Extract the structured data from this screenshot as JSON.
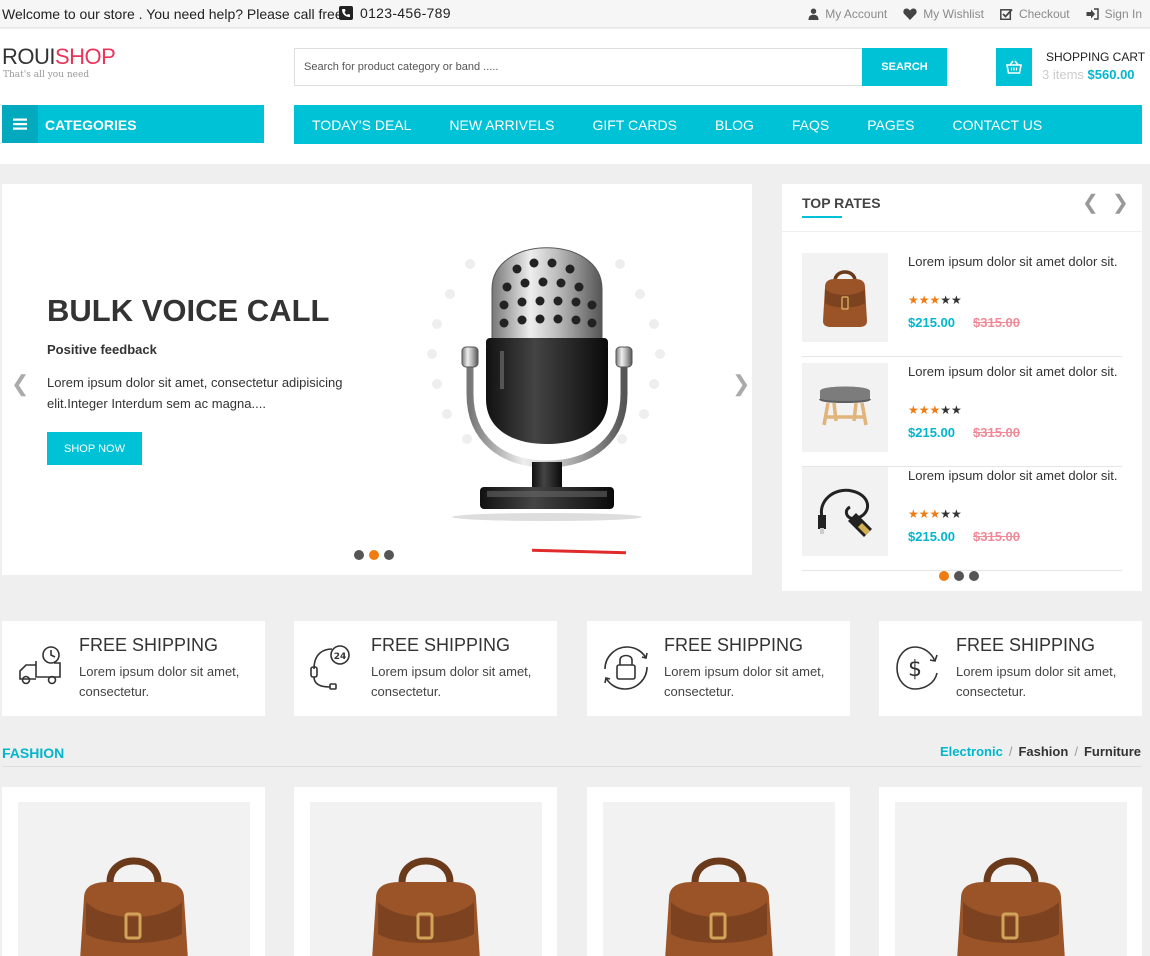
{
  "topbar": {
    "welcome": "Welcome to our store . You need help? Please call free",
    "phone": "0123-456-789",
    "links": [
      {
        "label": "My Account",
        "icon": "user-icon"
      },
      {
        "label": "My Wishlist",
        "icon": "heart-icon"
      },
      {
        "label": "Checkout",
        "icon": "checkbox-icon"
      },
      {
        "label": "Sign In",
        "icon": "sign-in-icon"
      }
    ]
  },
  "header": {
    "logo_part1": "ROUI",
    "logo_part2": "SHOP",
    "tagline": "That's all you need",
    "search_placeholder": "Search for product category or band .....",
    "search_button": "SEARCH",
    "cart_title": "SHOPPING CART",
    "cart_items": "3 items",
    "cart_total": "$560.00",
    "categories_label": "CATEGORIES",
    "nav": [
      "TODAY'S DEAL",
      "NEW ARRIVELS",
      "GIFT CARDS",
      "BLOG",
      "FAQS",
      "PAGES",
      "CONTACT US"
    ]
  },
  "hero": {
    "title": "BULK VOICE CALL",
    "subtitle": "Positive feedback",
    "description": "Lorem ipsum dolor sit amet, consectetur adipisicing elit.Integer Interdum sem ac magna....",
    "button": "SHOP NOW",
    "prev": "❮",
    "next": "❯",
    "active_slide": 2,
    "slide_count": 3
  },
  "top_rates": {
    "title": "TOP RATES",
    "prev": "❮",
    "next": "❯",
    "items": [
      {
        "name": "Lorem ipsum dolor sit amet dolor sit.",
        "rating": 3,
        "max_rating": 5,
        "price": "$215.00",
        "old_price": "$315.00",
        "image": "bag"
      },
      {
        "name": "Lorem ipsum dolor sit amet dolor sit.",
        "rating": 3,
        "max_rating": 5,
        "price": "$215.00",
        "old_price": "$315.00",
        "image": "stool"
      },
      {
        "name": "Lorem ipsum dolor sit amet dolor sit.",
        "rating": 3,
        "max_rating": 5,
        "price": "$215.00",
        "old_price": "$315.00",
        "image": "cable"
      }
    ],
    "active_page": 1,
    "page_count": 3
  },
  "features": [
    {
      "title": "FREE SHIPPING",
      "desc": "Lorem ipsum dolor sit amet, consectetur.",
      "icon": "truck-icon"
    },
    {
      "title": "FREE SHIPPING",
      "desc": "Lorem ipsum dolor sit amet, consectetur.",
      "icon": "support-24-icon"
    },
    {
      "title": "FREE SHIPPING",
      "desc": "Lorem ipsum dolor sit amet, consectetur.",
      "icon": "secure-lock-icon"
    },
    {
      "title": "FREE SHIPPING",
      "desc": "Lorem ipsum dolor sit amet, consectetur.",
      "icon": "money-back-icon"
    }
  ],
  "fashion": {
    "title": "FASHION",
    "tabs": [
      "Electronic",
      "Fashion",
      "Furniture"
    ],
    "active_tab": 0
  },
  "colors": {
    "accent": "#00c2d6",
    "accent_dark": "#03aabd",
    "brand_red": "#e8355a",
    "star": "#f07c12",
    "old_price": "#f08a99"
  }
}
